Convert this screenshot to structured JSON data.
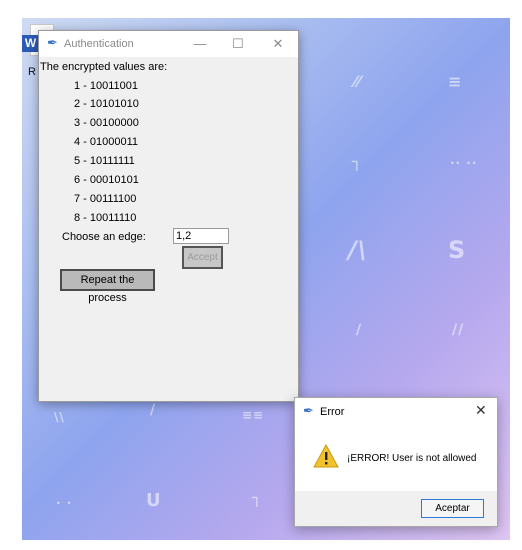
{
  "desktop": {
    "icon_letter": "W",
    "icon_caption": "R"
  },
  "auth_window": {
    "title": "Authentication",
    "controls": {
      "minimize": "—",
      "maximize": "☐",
      "close": "✕"
    },
    "heading": "The encrypted values are:",
    "values": [
      "1 - 10011001",
      "2 - 10101010",
      "3 - 00100000",
      "4 - 01000011",
      "5 - 10111111",
      "6 - 00010101",
      "7 - 00111100",
      "8 - 10011110"
    ],
    "edge_label": "Choose an edge:",
    "edge_input_value": "1,2",
    "accept_label": "Accept",
    "repeat_label": "Repeat the process"
  },
  "error_dialog": {
    "title": "Error",
    "close": "✕",
    "message": "¡ERROR! User is not allowed",
    "ok_label": "Aceptar",
    "warning_icon": "warning-icon"
  },
  "colors": {
    "feather": "#3a6fc9",
    "warning": "#f2c12e",
    "ok_border": "#2f78d4"
  }
}
